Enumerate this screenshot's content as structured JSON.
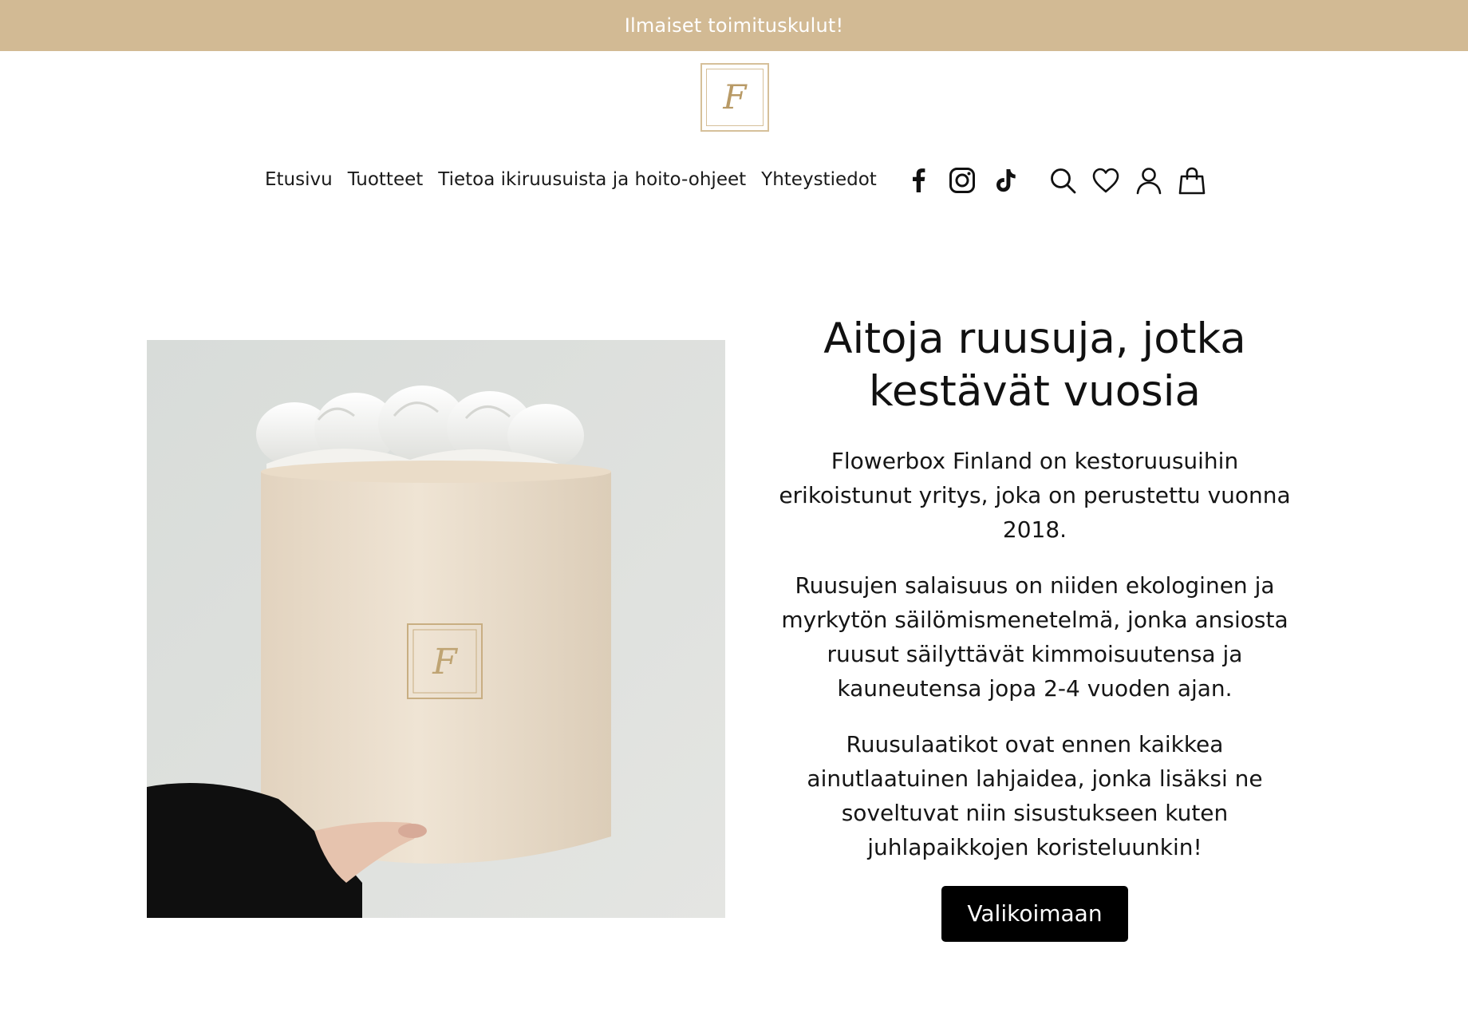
{
  "announcement": {
    "text": "Ilmaiset toimituskulut!"
  },
  "colors": {
    "announcement_bg": "#d2ba94",
    "logo_gold": "#d6c09a",
    "cta_bg": "#000000",
    "cta_text": "#ffffff"
  },
  "logo": {
    "letter": "F",
    "icon": "monogram-logo"
  },
  "nav": {
    "links": [
      "Etusivu",
      "Tuotteet",
      "Tietoa ikiruusuista ja hoito-ohjeet",
      "Yhteystiedot"
    ],
    "social_icons": [
      "facebook-icon",
      "instagram-icon",
      "tiktok-icon"
    ],
    "utility_icons": [
      "search-icon",
      "heart-icon",
      "account-icon",
      "cart-icon"
    ]
  },
  "hero": {
    "image": {
      "description_icon": "rose-box-photo",
      "box_monogram": "F"
    },
    "title_line1": "Aitoja ruusuja, jotka",
    "title_line2": "kestävät vuosia",
    "paragraph1_lines": [
      "Flowerbox Finland on kestoruusuihin",
      "erikoistunut yritys, joka on perustettu vuonna",
      "2018."
    ],
    "paragraph2_lines": [
      "Ruusujen salaisuus on niiden ekologinen ja",
      "myrkytön säilömismenetelmä, jonka ansiosta",
      "ruusut säilyttävät kimmoisuutensa ja",
      "kauneutensa jopa 2-4 vuoden ajan."
    ],
    "paragraph3_lines": [
      "Ruusulaatikot ovat ennen kaikkea",
      "ainutlaatuinen lahjaidea, jonka lisäksi ne",
      "soveltuvat niin sisustukseen kuten",
      "juhlapaikkojen koristeluunkin!"
    ],
    "cta_label": "Valikoimaan"
  }
}
